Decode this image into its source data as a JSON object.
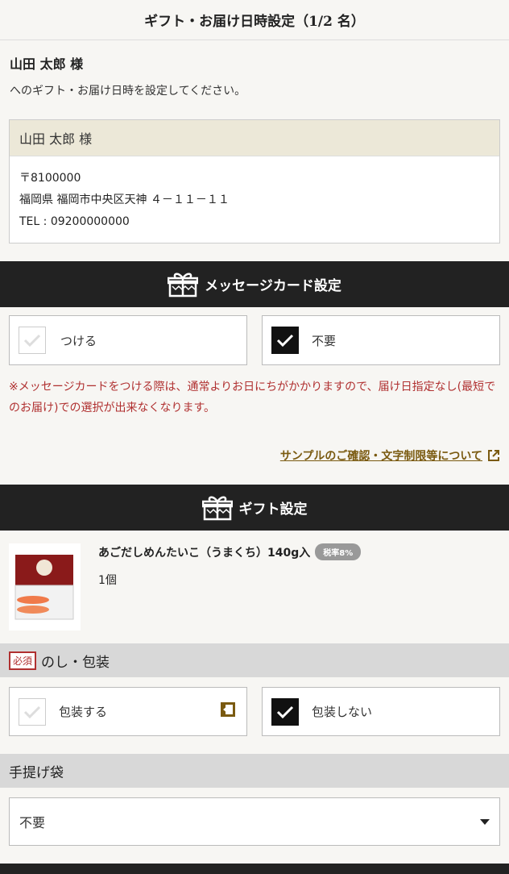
{
  "header": {
    "title": "ギフト・お届け日時設定（1/2 名）"
  },
  "recipient": {
    "name": "山田 太郎 様",
    "description": "へのギフト・お届け日時を設定してください。"
  },
  "address": {
    "name": "山田 太郎 様",
    "postal": "〒8100000",
    "line": "福岡県 福岡市中央区天神 ４－１１－１１",
    "tel": "TEL : 09200000000"
  },
  "message_card": {
    "title": "メッセージカード設定",
    "options": [
      {
        "label": "つける",
        "checked": false
      },
      {
        "label": "不要",
        "checked": true
      }
    ],
    "notice": "※メッセージカードをつける際は、通常よりお日にちがかかりますので、届け日指定なし(最短でのお届け)での選択が出来なくなります。",
    "sample_link": "サンプルのご確認・文字制限等について"
  },
  "gift": {
    "title": "ギフト設定",
    "product": {
      "name": "あごだしめんたいこ（うまくち）140g入",
      "tax": "税率8%",
      "qty": "1個"
    },
    "noshi": {
      "required": "必須",
      "title": "のし・包装",
      "options": [
        {
          "label": "包装する",
          "checked": false
        },
        {
          "label": "包装しない",
          "checked": true
        }
      ]
    },
    "bag": {
      "title": "手提げ袋",
      "selected": "不要"
    }
  }
}
